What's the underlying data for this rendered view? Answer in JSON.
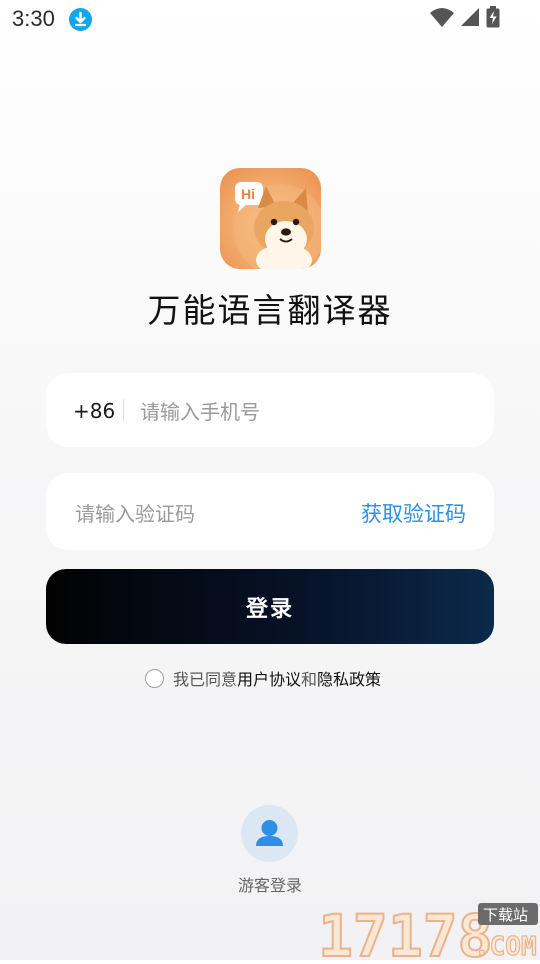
{
  "status_bar": {
    "time": "3:30"
  },
  "app": {
    "title": "万能语言翻译器",
    "icon_badge": "Hi"
  },
  "phone": {
    "prefix": "+86",
    "placeholder": "请输入手机号"
  },
  "code": {
    "placeholder": "请输入验证码",
    "get_code_label": "获取验证码"
  },
  "login": {
    "label": "登录"
  },
  "agreement": {
    "prefix": "我已同意",
    "terms": "用户协议",
    "and": "和",
    "privacy": "隐私政策"
  },
  "guest": {
    "label": "游客登录"
  },
  "watermark": {
    "site": "17178",
    "tag": "下载站",
    "domain": ".COM"
  },
  "colors": {
    "accent_blue": "#2f8fe6",
    "button_start": "#020202",
    "button_end": "#0b2a4b",
    "download_badge": "#10a7ee"
  }
}
